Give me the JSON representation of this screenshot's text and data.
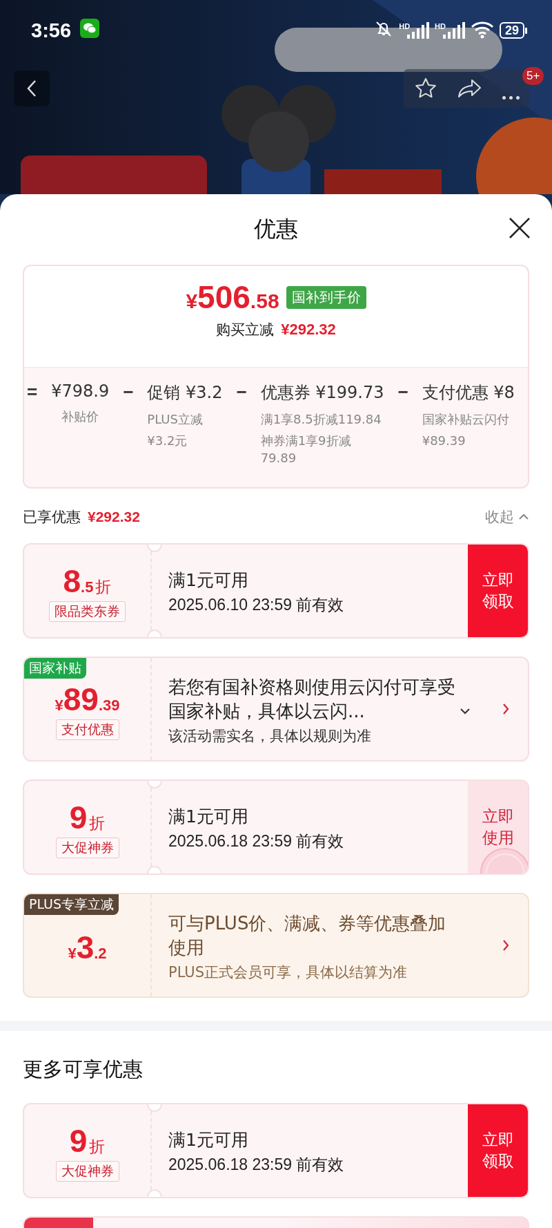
{
  "status_bar": {
    "time": "3:56",
    "signals": [
      {
        "label": "HD"
      },
      {
        "label": "HD"
      }
    ],
    "battery": "29"
  },
  "header": {
    "more_badge": "5+"
  },
  "sheet": {
    "title": "优惠"
  },
  "price_summary": {
    "currency": "¥",
    "price_integer": "506",
    "price_decimal": ".58",
    "tag": "国补到手价",
    "reduction_label": "购买立减",
    "reduction_amount": "¥292.32",
    "breakdown": [
      {
        "operator": "=",
        "value": "¥798.9",
        "notes": [
          "补贴价"
        ]
      },
      {
        "operator": "−",
        "value": "促销 ¥3.2",
        "notes": [
          "PLUS立减",
          "¥3.2元"
        ]
      },
      {
        "operator": "−",
        "value": "优惠券 ¥199.73",
        "notes": [
          "满1享8.5折减119.84",
          "神券满1享9折减79.89"
        ]
      },
      {
        "operator": "−",
        "value": "支付优惠 ¥8",
        "notes": [
          "国家补贴云闪付",
          "¥89.39"
        ]
      }
    ]
  },
  "applied": {
    "label": "已享优惠",
    "amount": "¥292.32",
    "toggle": "收起",
    "expanded": true,
    "coupons": [
      {
        "kind": "discount",
        "plus": false,
        "value_main": "8",
        "value_sub": ".5",
        "unit": "折",
        "type_label": "限品类东券",
        "title": "满1元可用",
        "subtitle": "2025.06.10 23:59 前有效",
        "action": {
          "kind": "button",
          "label": "立即领取",
          "claimed": false
        }
      },
      {
        "kind": "amount",
        "plus": false,
        "corner_tag": {
          "label": "国家补贴",
          "color": "#1fa84a"
        },
        "currency": "¥",
        "value_main": "89",
        "value_sub": ".39",
        "type_label": "支付优惠",
        "description": "若您有国补资格则使用云闪付可享受国家补贴，具体以云闪...",
        "expandable": true,
        "note": "该活动需实名，具体以规则为准",
        "action": {
          "kind": "chevron"
        }
      },
      {
        "kind": "discount",
        "plus": false,
        "value_main": "9",
        "unit": "折",
        "type_label": "大促神券",
        "title": "满1元可用",
        "subtitle": "2025.06.18 23:59 前有效",
        "action": {
          "kind": "button",
          "label": "立即使用",
          "claimed": true
        }
      },
      {
        "kind": "amount",
        "plus": true,
        "corner_tag": {
          "label": "PLUS专享立减",
          "color": "#5b4535"
        },
        "currency": "¥",
        "value_main": "3",
        "value_sub": ".2",
        "description": "可与PLUS价、满减、券等优惠叠加使用",
        "note": "PLUS正式会员可享，具体以结算为准",
        "action": {
          "kind": "chevron"
        }
      }
    ]
  },
  "more": {
    "title": "更多可享优惠",
    "coupons": [
      {
        "kind": "discount",
        "plus": false,
        "value_main": "9",
        "unit": "折",
        "type_label": "大促神券",
        "title": "满1元可用",
        "subtitle": "2025.06.18 23:59 前有效",
        "action": {
          "kind": "button",
          "label": "立即领取",
          "claimed": false
        }
      }
    ]
  }
}
